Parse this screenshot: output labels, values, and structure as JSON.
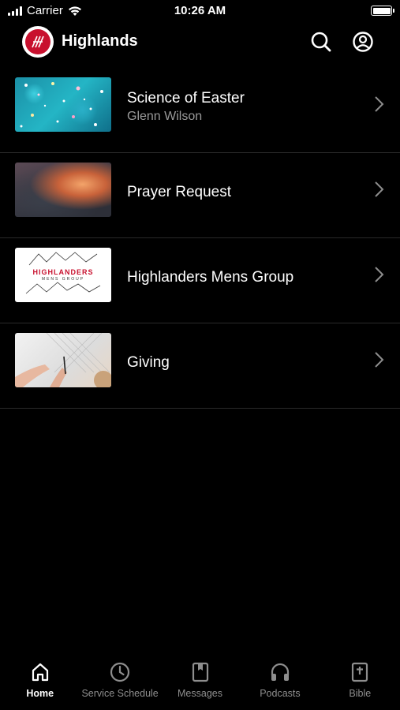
{
  "status_bar": {
    "carrier": "Carrier",
    "time": "10:26 AM"
  },
  "header": {
    "title": "Highlands",
    "logo_icon": "highlands-logo",
    "search_icon": "search-icon",
    "account_icon": "account-icon"
  },
  "items": [
    {
      "title": "Science of Easter",
      "subtitle": "Glenn Wilson"
    },
    {
      "title": "Prayer Request",
      "subtitle": ""
    },
    {
      "title": "Highlanders Mens Group",
      "subtitle": "",
      "thumb_text": "HIGHLANDERS",
      "thumb_subtext": "MENS GROUP"
    },
    {
      "title": "Giving",
      "subtitle": ""
    }
  ],
  "tabs": [
    {
      "label": "Home",
      "icon": "home-icon",
      "active": true
    },
    {
      "label": "Service Schedule",
      "icon": "clock-icon",
      "active": false
    },
    {
      "label": "Messages",
      "icon": "book-icon",
      "active": false
    },
    {
      "label": "Podcasts",
      "icon": "headphones-icon",
      "active": false
    },
    {
      "label": "Bible",
      "icon": "bible-icon",
      "active": false
    }
  ],
  "colors": {
    "background": "#000000",
    "text": "#ffffff",
    "subtext": "#9a9a9a",
    "inactive_tab": "#8e8e8e",
    "brand_red": "#c8102e"
  }
}
